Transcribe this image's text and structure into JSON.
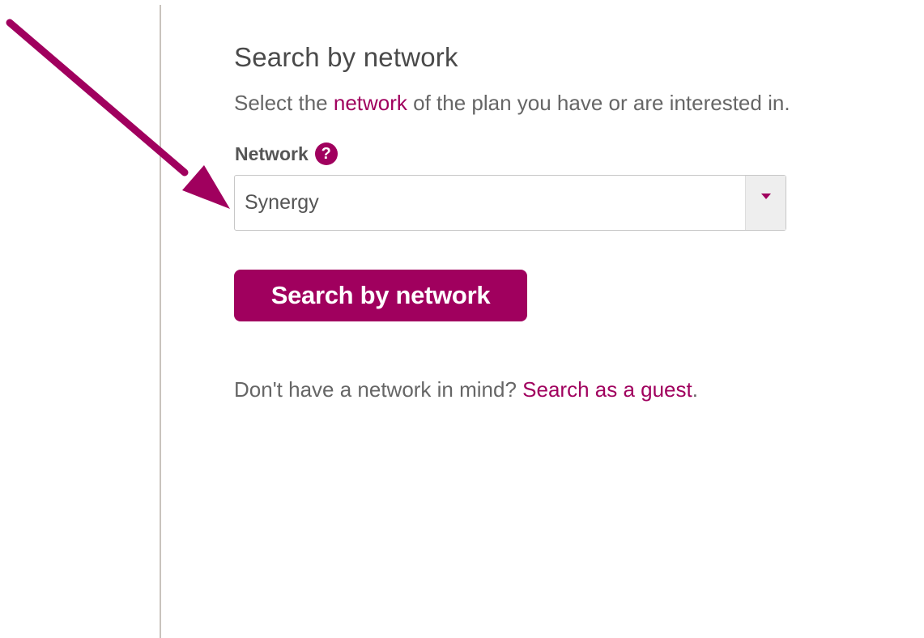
{
  "colors": {
    "accent": "#a0005e",
    "text": "#555555",
    "divider": "#c9c3bd"
  },
  "annotation": {
    "icon": "arrow-pointer-icon"
  },
  "form": {
    "heading": "Search by network",
    "description": {
      "before": "Select the ",
      "link": "network",
      "after": " of the plan you have or are interested in."
    },
    "network_label": "Network",
    "help_icon_glyph": "?",
    "network_select": {
      "selected": "Synergy"
    },
    "search_button_label": "Search by network",
    "guest": {
      "prefix": "Don't have a network in mind? ",
      "link": "Search as a guest",
      "suffix": "."
    }
  }
}
